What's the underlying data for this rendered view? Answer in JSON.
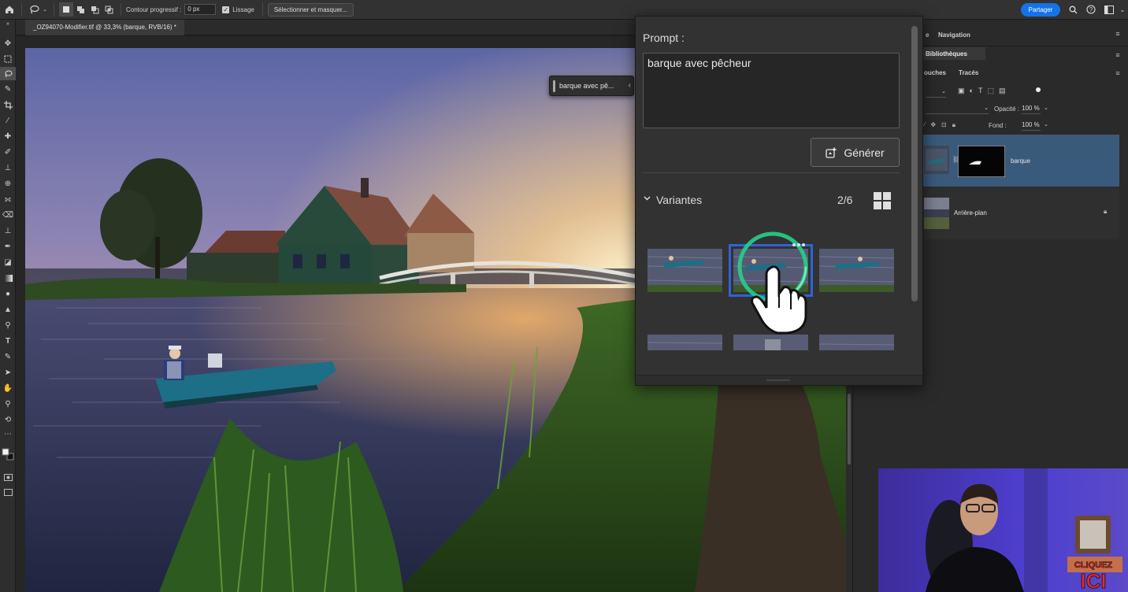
{
  "options_bar": {
    "home_icon": "home-icon",
    "lasso_icon": "lasso-icon",
    "progressive_contour_label": "Contour progressif :",
    "progressive_contour_value": "0 px",
    "smoothing_label": "Lissage",
    "smoothing_checked": true,
    "select_mask_label": "Sélectionner et masquer...",
    "share_label": "Partager",
    "accent": "#1473e6"
  },
  "document": {
    "tab_title": "_OZ94070-Modifier.tif @ 33,3% (barque, RVB/16) *"
  },
  "generative_tag": {
    "label": "barque avec pê..."
  },
  "prompt_panel": {
    "title": "Prompt :",
    "prompt_text": "barque avec pêcheur",
    "generate_label": "Générer",
    "variants_label": "Variantes",
    "variants_count": "2/6",
    "selected_variant": 2
  },
  "panels": {
    "tab_partial": "e",
    "tab_navigation": "Navigation",
    "tab_libraries": "Bibliothèques",
    "tab_channels_partial": "ouches",
    "tab_paths": "Tracés",
    "opacity_label": "Opacité :",
    "opacity_value": "100 %",
    "fill_label": "Fond :",
    "fill_value": "100 %",
    "layers": [
      {
        "name": "barque",
        "selected": true
      },
      {
        "name": "Arrière-plan",
        "locked": true
      }
    ]
  },
  "overlay": {
    "cta_line1": "CLIQUEZ",
    "cta_line2": "ICI"
  }
}
